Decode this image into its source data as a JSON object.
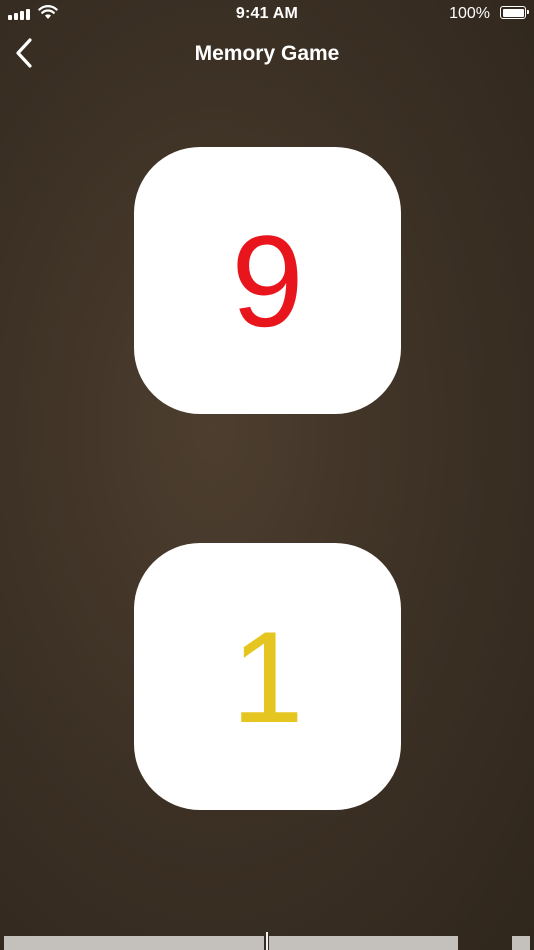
{
  "status_bar": {
    "time": "9:41 AM",
    "battery_percent": "100%",
    "signal_icon": "signal-bars-icon",
    "wifi_icon": "wifi-icon",
    "battery_icon": "battery-icon",
    "battery_level": 1.0
  },
  "nav": {
    "title": "Memory Game",
    "back_icon": "chevron-left-icon"
  },
  "cards": [
    {
      "value": "9",
      "color": "#e8161c"
    },
    {
      "value": "1",
      "color": "#e5c520"
    }
  ],
  "colors": {
    "background": "#3f3327",
    "card_background": "#ffffff",
    "bottom_bar": "#c4c1bd"
  }
}
